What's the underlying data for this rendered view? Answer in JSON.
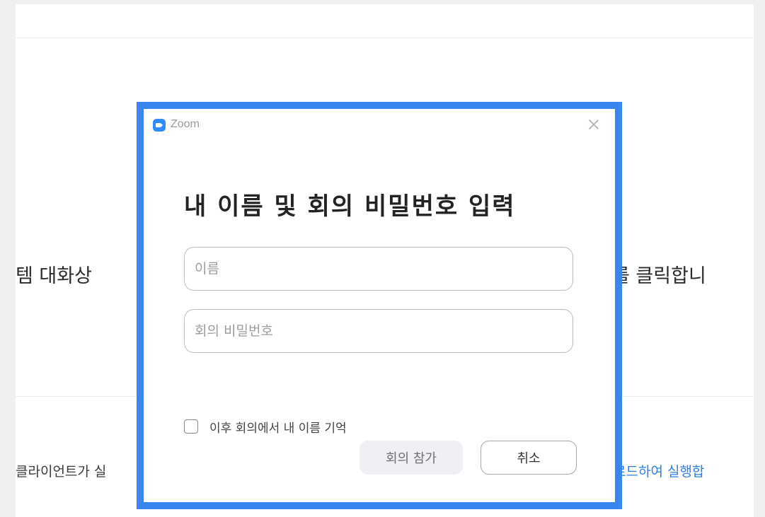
{
  "background": {
    "instruction_left": "템 대화상",
    "instruction_right": "를 클릭합니",
    "client_left": "클라이언트가 실",
    "download_link_right": "로드하여 실행합"
  },
  "dialog": {
    "app_title": "Zoom",
    "heading": "내 이름 및 회의 비밀번호 입력",
    "name_field": {
      "placeholder": "이름",
      "value": ""
    },
    "password_field": {
      "placeholder": "회의 비밀번호",
      "value": ""
    },
    "remember_label": "이후 회의에서 내 이름 기억",
    "join_button": "회의 참가",
    "cancel_button": "취소"
  },
  "colors": {
    "highlight_border": "#3a86f0",
    "zoom_blue": "#2d8cff",
    "link": "#2d7fe8"
  }
}
